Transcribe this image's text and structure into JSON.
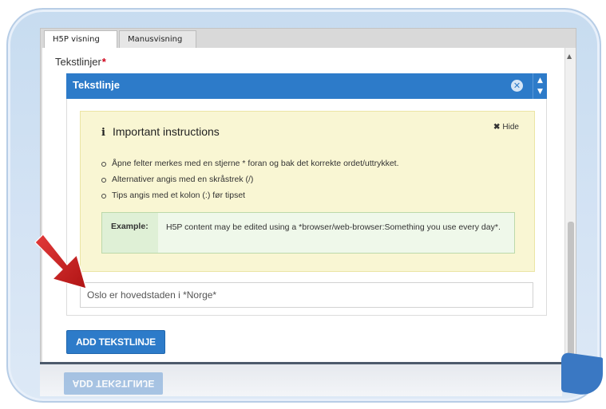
{
  "tabs": [
    {
      "label": "H5P visning",
      "active": true
    },
    {
      "label": "Manusvisning",
      "active": false
    }
  ],
  "field": {
    "label": "Tekstlinjer",
    "required_mark": "*"
  },
  "group": {
    "title": "Tekstlinje",
    "remove_icon": "close-circle-icon",
    "order_icon": "chevron-up-down-icon"
  },
  "instructions": {
    "title": "Important instructions",
    "hide_label": "Hide",
    "items": [
      "Åpne felter merkes med en stjerne * foran og bak det korrekte ordet/uttrykket.",
      "Alternativer angis med en skråstrek (/)",
      "Tips angis med et kolon (:) før tipset"
    ],
    "example_label": "Example:",
    "example_text": "H5P content may be edited using a *browser/web-browser:Something you use every day*."
  },
  "text_line": {
    "value": "Oslo er hovedstaden i *Norge*"
  },
  "add_button": {
    "label": "ADD TEKSTLINJE"
  },
  "colors": {
    "accent": "#2d7bc9",
    "required": "#d0021b",
    "instructions_bg": "#f9f6d3",
    "example_bg": "#eff8ea",
    "arrow": "#cc1f1f"
  }
}
